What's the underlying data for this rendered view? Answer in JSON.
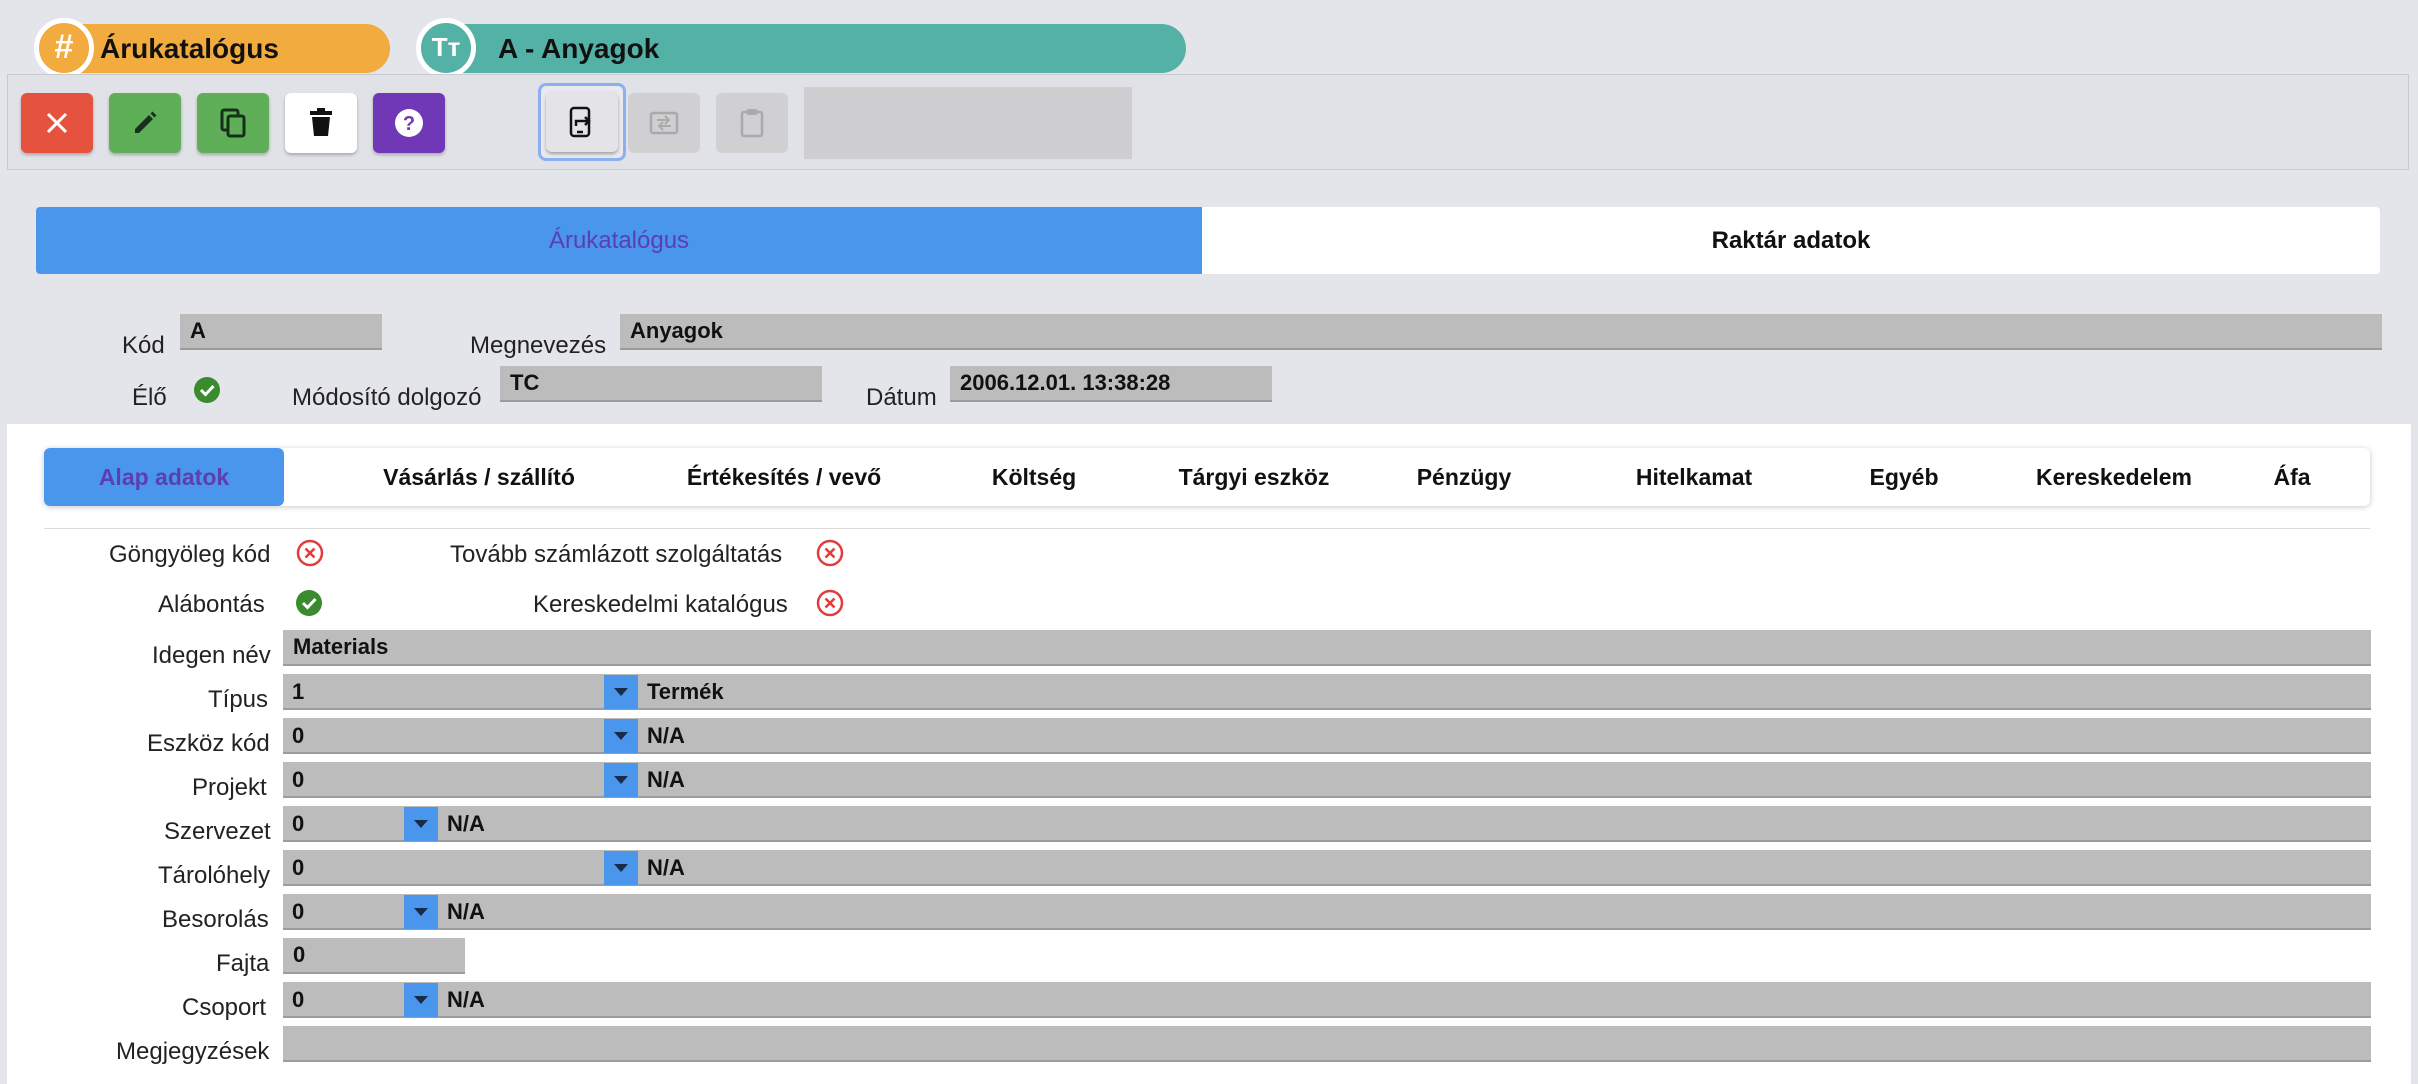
{
  "header": {
    "module_title": "Árukatalógus",
    "module_icon": "hash-icon",
    "record_title": "A - Anyagok",
    "record_icon": "text-type-icon"
  },
  "toolbar": {
    "buttons": [
      "close-icon",
      "edit-icon",
      "copy-icon",
      "delete-icon",
      "help-icon",
      "export-icon",
      "import-icon",
      "paste-icon"
    ],
    "search_value": ""
  },
  "main_tabs": [
    "Árukatalógus",
    "Raktár adatok"
  ],
  "record": {
    "kod_label": "Kód",
    "kod_value": "A",
    "megnevezes_label": "Megnevezés",
    "megnevezes_value": "Anyagok",
    "elo_label": "Élő",
    "modosito_label": "Módosító dolgozó",
    "modosito_value": "TC",
    "datum_label": "Dátum",
    "datum_value": "2006.12.01. 13:38:28"
  },
  "sub_tabs": [
    "Alap adatok",
    "Vásárlás / szállító",
    "Értékesítés / vevő",
    "Költség",
    "Tárgyi eszköz",
    "Pénzügy",
    "Hitelkamat",
    "Egyéb",
    "Kereskedelem",
    "Áfa"
  ],
  "flags": {
    "gongyoleg_label": "Göngyöleg kód",
    "tovabb_label": "Tovább számlázott szolgáltatás",
    "alabontas_label": "Alábontás",
    "keresk_katalogus_label": "Kereskedelmi katalógus"
  },
  "fields": {
    "idegen_nev_label": "Idegen név",
    "idegen_nev_value": "Materials",
    "tipus_label": "Típus",
    "tipus_code": "1",
    "tipus_text": "Termék",
    "eszkoz_label": "Eszköz kód",
    "eszkoz_code": "0",
    "eszkoz_text": "N/A",
    "projekt_label": "Projekt",
    "projekt_code": "0",
    "projekt_text": "N/A",
    "szervezet_label": "Szervezet",
    "szervezet_code": "0",
    "szervezet_text": "N/A",
    "tarolohely_label": "Tárolóhely",
    "tarolohely_code": "0",
    "tarolohely_text": "N/A",
    "besorolas_label": "Besorolás",
    "besorolas_code": "0",
    "besorolas_text": "N/A",
    "fajta_label": "Fajta",
    "fajta_value": "0",
    "csoport_label": "Csoport",
    "csoport_code": "0",
    "csoport_text": "N/A",
    "megjegyzesek_label": "Megjegyzések",
    "megjegyzesek_value": ""
  },
  "colors": {
    "accent_blue": "#4a96ec",
    "orange": "#f2ab3e",
    "teal": "#53b1a6",
    "ok_green": "#3a8a2e",
    "error_red": "#e23b3b"
  }
}
